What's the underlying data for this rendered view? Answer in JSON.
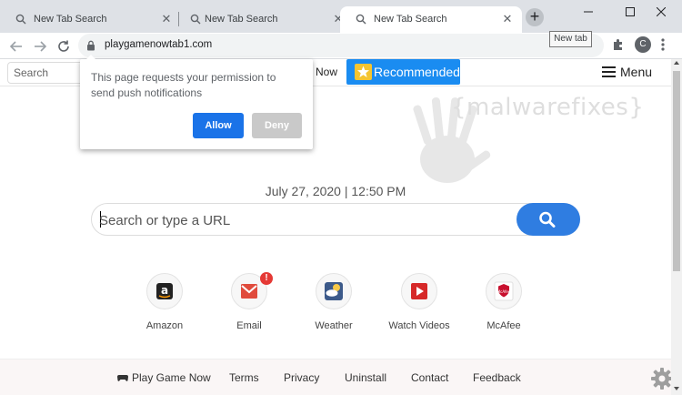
{
  "tabs": [
    {
      "title": "New Tab Search",
      "close": "✕"
    },
    {
      "title": "New Tab Search",
      "close": "✕"
    },
    {
      "title": "New Tab Search",
      "close": "✕",
      "active": true
    }
  ],
  "new_tab": {
    "symbol": "+",
    "tooltip": "New tab"
  },
  "toolbar": {
    "url": "playgamenowtab1.com",
    "profile_initial": "C"
  },
  "site": {
    "search_placeholder": "Search",
    "top_link": "Now",
    "recommended": "Recommended",
    "menu": "Menu",
    "watermark": "{malwarefixes}",
    "datetime": "July 27, 2020 | 12:50 PM",
    "search_input_placeholder": "Search or type a URL"
  },
  "shortcuts": [
    {
      "label": "Amazon",
      "icon": "amazon-icon"
    },
    {
      "label": "Email",
      "icon": "email-icon",
      "badge": "!"
    },
    {
      "label": "Weather",
      "icon": "weather-icon"
    },
    {
      "label": "Watch Videos",
      "icon": "video-play-icon"
    },
    {
      "label": "McAfee",
      "icon": "mcafee-icon",
      "mark_text": "McAfee"
    }
  ],
  "footer": {
    "links": [
      "Play Game Now",
      "Terms",
      "Privacy",
      "Uninstall",
      "Contact",
      "Feedback"
    ]
  },
  "permission_popup": {
    "message": "This page requests your permission to send push notifications",
    "allow": "Allow",
    "deny": "Deny"
  },
  "colors": {
    "accent_blue": "#1a8cf1",
    "search_button": "#2f7de1",
    "allow_button": "#1a73e8",
    "deny_button": "#c9c9c9",
    "badge_red": "#e53935"
  }
}
